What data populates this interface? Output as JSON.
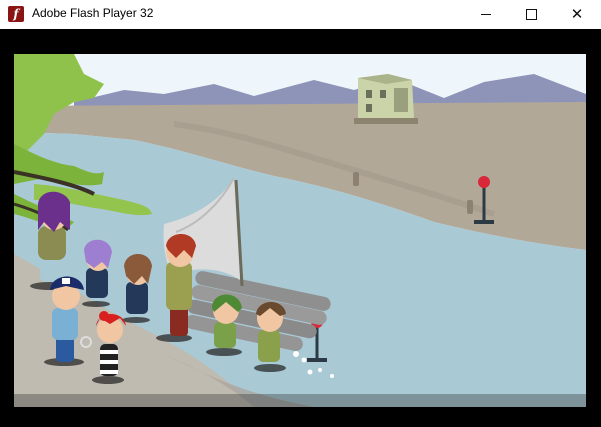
{
  "window": {
    "title": "Adobe Flash Player 32",
    "icon": "flash-player-icon",
    "controls": {
      "minimize": "minimize-icon",
      "maximize": "maximize-icon",
      "close": "close-icon"
    }
  },
  "scene": {
    "colors": {
      "sky": "#eef6fb",
      "mountains": "#8e93b8",
      "far_bank": "#b2a898",
      "river": "#a9c9d5",
      "near_bank": "#c0bbb1",
      "foliage": "#8fc24a"
    }
  }
}
